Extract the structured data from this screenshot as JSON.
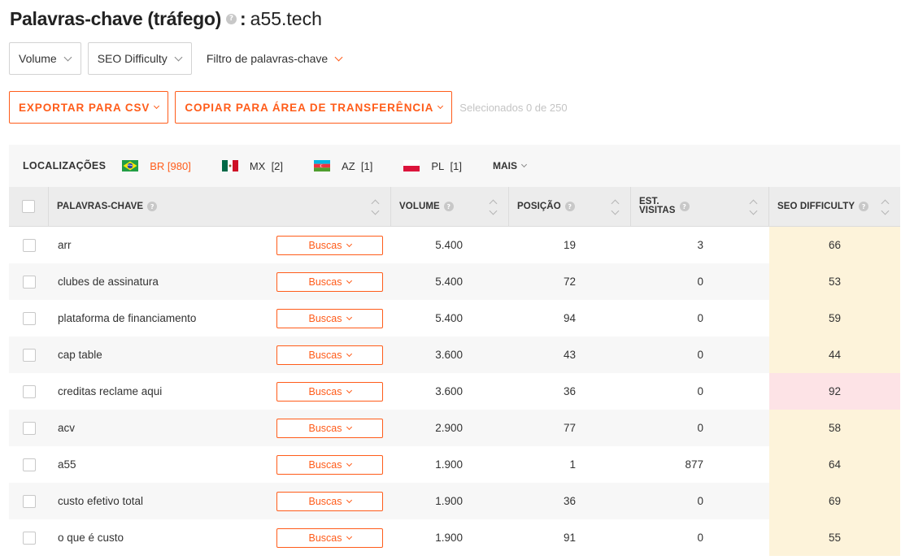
{
  "header": {
    "title": "Palavras-chave (tráfego)",
    "help": "?",
    "colon": ":",
    "domain": "a55.tech"
  },
  "filters": {
    "volume": "Volume",
    "seo_difficulty": "SEO Difficulty",
    "keyword_filter": "Filtro de palavras-chave"
  },
  "actions": {
    "export_csv": "EXPORTAR PARA CSV",
    "copy_clipboard": "COPIAR PARA ÁREA DE TRANSFERÊNCIA",
    "selected_info": "Selecionados 0 de 250"
  },
  "locations": {
    "label": "LOCALIZAÇÕES",
    "items": [
      {
        "code": "BR",
        "count": "[980]",
        "flag": "brazil-flag",
        "active": true
      },
      {
        "code": "MX",
        "count": "[2]",
        "flag": "mexico-flag",
        "active": false
      },
      {
        "code": "AZ",
        "count": "[1]",
        "flag": "azerbaijan-flag",
        "active": false
      },
      {
        "code": "PL",
        "count": "[1]",
        "flag": "poland-flag",
        "active": false
      }
    ],
    "more": "MAIS"
  },
  "table": {
    "columns": {
      "keywords": "PALAVRAS-CHAVE",
      "volume": "VOLUME",
      "position": "POSIÇÃO",
      "est_visits_1": "EST.",
      "est_visits_2": "VISITAS",
      "seo_difficulty": "SEO DIFFICULTY"
    },
    "buscas_label": "Buscas",
    "rows": [
      {
        "keyword": "arr",
        "volume": "5.400",
        "position": "19",
        "visits": "3",
        "seo": "66",
        "seo_color": "#fdf3da"
      },
      {
        "keyword": "clubes de assinatura",
        "volume": "5.400",
        "position": "72",
        "visits": "0",
        "seo": "53",
        "seo_color": "#fdf3da"
      },
      {
        "keyword": "plataforma de financiamento",
        "volume": "5.400",
        "position": "94",
        "visits": "0",
        "seo": "59",
        "seo_color": "#fdf3da"
      },
      {
        "keyword": "cap table",
        "volume": "3.600",
        "position": "43",
        "visits": "0",
        "seo": "44",
        "seo_color": "#fdf3da"
      },
      {
        "keyword": "creditas reclame aqui",
        "volume": "3.600",
        "position": "36",
        "visits": "0",
        "seo": "92",
        "seo_color": "#fde3e6"
      },
      {
        "keyword": "acv",
        "volume": "2.900",
        "position": "77",
        "visits": "0",
        "seo": "58",
        "seo_color": "#fdf3da"
      },
      {
        "keyword": "a55",
        "volume": "1.900",
        "position": "1",
        "visits": "877",
        "seo": "64",
        "seo_color": "#fdf3da"
      },
      {
        "keyword": "custo efetivo total",
        "volume": "1.900",
        "position": "36",
        "visits": "0",
        "seo": "69",
        "seo_color": "#fdf3da"
      },
      {
        "keyword": "o que é custo",
        "volume": "1.900",
        "position": "91",
        "visits": "0",
        "seo": "55",
        "seo_color": "#fdf3da"
      }
    ]
  },
  "colors": {
    "accent": "#ff5c1a",
    "seo_medium": "#fdf3da",
    "seo_hard": "#fde3e6"
  }
}
